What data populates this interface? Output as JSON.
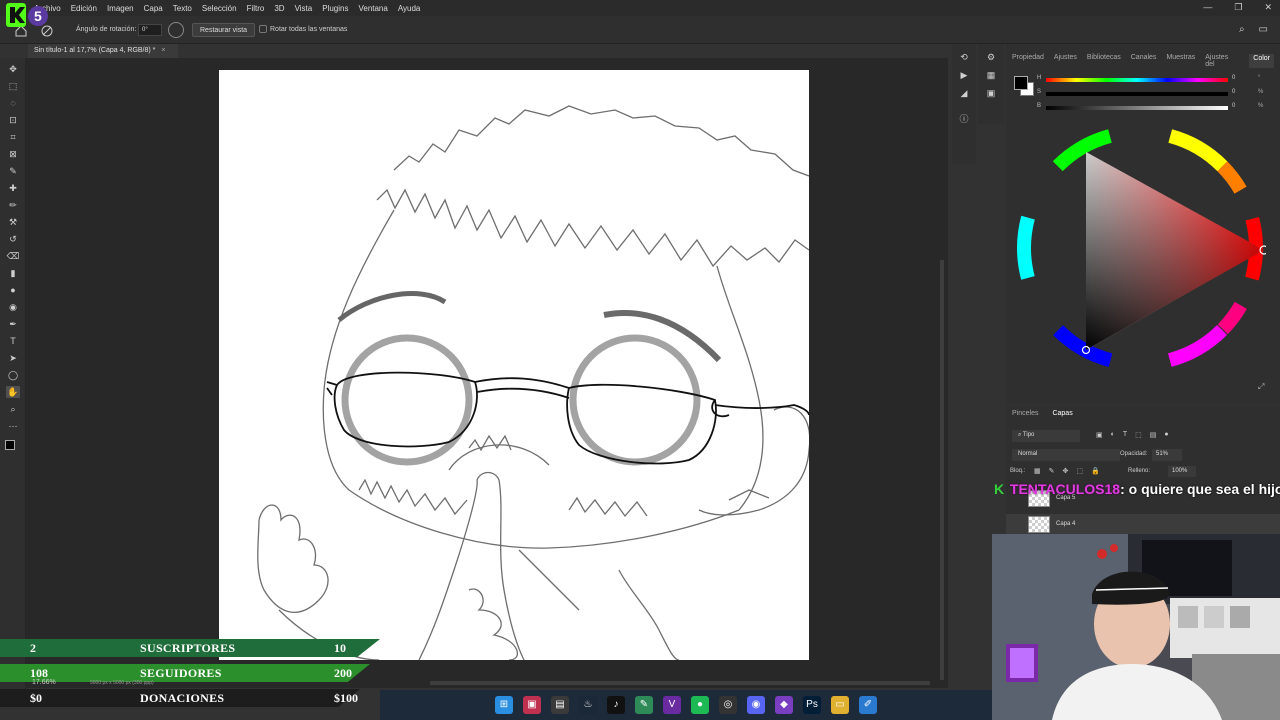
{
  "menubar": {
    "items": [
      "Archivo",
      "Edición",
      "Imagen",
      "Capa",
      "Texto",
      "Selección",
      "Filtro",
      "3D",
      "Vista",
      "Plugins",
      "Ventana",
      "Ayuda"
    ],
    "window_controls": [
      "—",
      "❐",
      "✕"
    ]
  },
  "options": {
    "angle_label": "Ángulo de rotación:",
    "angle_value": "0°",
    "restore_button": "Restaurar vista",
    "rotate_all_label": "Rotar todas las ventanas"
  },
  "document": {
    "tab_title": "Sin título-1 al 17,7% (Capa 4, RGB/8) *",
    "tab_close": "×",
    "zoom": "17.66%",
    "dimensions": "5000 px x 5000 px (300 ppp)"
  },
  "tools": [
    "move-tool",
    "marquee-tool",
    "lasso-tool",
    "object-select-tool",
    "crop-tool",
    "frame-tool",
    "eyedropper-tool",
    "healing-tool",
    "brush-tool",
    "stamp-tool",
    "history-brush-tool",
    "eraser-tool",
    "gradient-tool",
    "blur-tool",
    "dodge-tool",
    "pen-tool",
    "type-tool",
    "path-select-tool",
    "shape-tool",
    "hand-tool",
    "zoom-tool",
    "more-tool"
  ],
  "color_panel": {
    "tabs": [
      "Propiedad",
      "Ajustes",
      "Bibliotecas",
      "Canales",
      "Muestras",
      "Ajustes del",
      "Color"
    ],
    "active_tab": "Color",
    "sliders": [
      {
        "label": "H",
        "value": "0",
        "unit": "°"
      },
      {
        "label": "S",
        "value": "0",
        "unit": "%"
      },
      {
        "label": "B",
        "value": "0",
        "unit": "%"
      }
    ]
  },
  "layers_panel": {
    "tabs": [
      "Pinceles",
      "Capas"
    ],
    "active_tab": "Capas",
    "filter": "Tipo",
    "blend_mode": "Normal",
    "opacity_label": "Opacidad:",
    "opacity_value": "51%",
    "lock_label": "Bloq.:",
    "fill_label": "Relleno:",
    "fill_value": "100%",
    "layers": [
      {
        "name": "Capa 5"
      },
      {
        "name": "Capa 4"
      }
    ]
  },
  "chat": {
    "user": "TENTACULOS18",
    "message": ": o quiere que sea el hijo c"
  },
  "stats": [
    {
      "current": "2",
      "name": "SUSCRIPTORES",
      "goal": "10",
      "color": "#1f6d3a"
    },
    {
      "current": "108",
      "name": "SEGUIDORES",
      "goal": "200",
      "color": "#2b8f2b"
    },
    {
      "current": "$0",
      "name": "DONACIONES",
      "goal": "$100",
      "color": "#1d1d1d"
    }
  ],
  "taskbar": [
    "windows-start",
    "app-icon",
    "store",
    "steam",
    "tiktok",
    "notepad",
    "vegas",
    "spotify",
    "obs",
    "discord",
    "vs",
    "photoshop",
    "files",
    "paint"
  ]
}
